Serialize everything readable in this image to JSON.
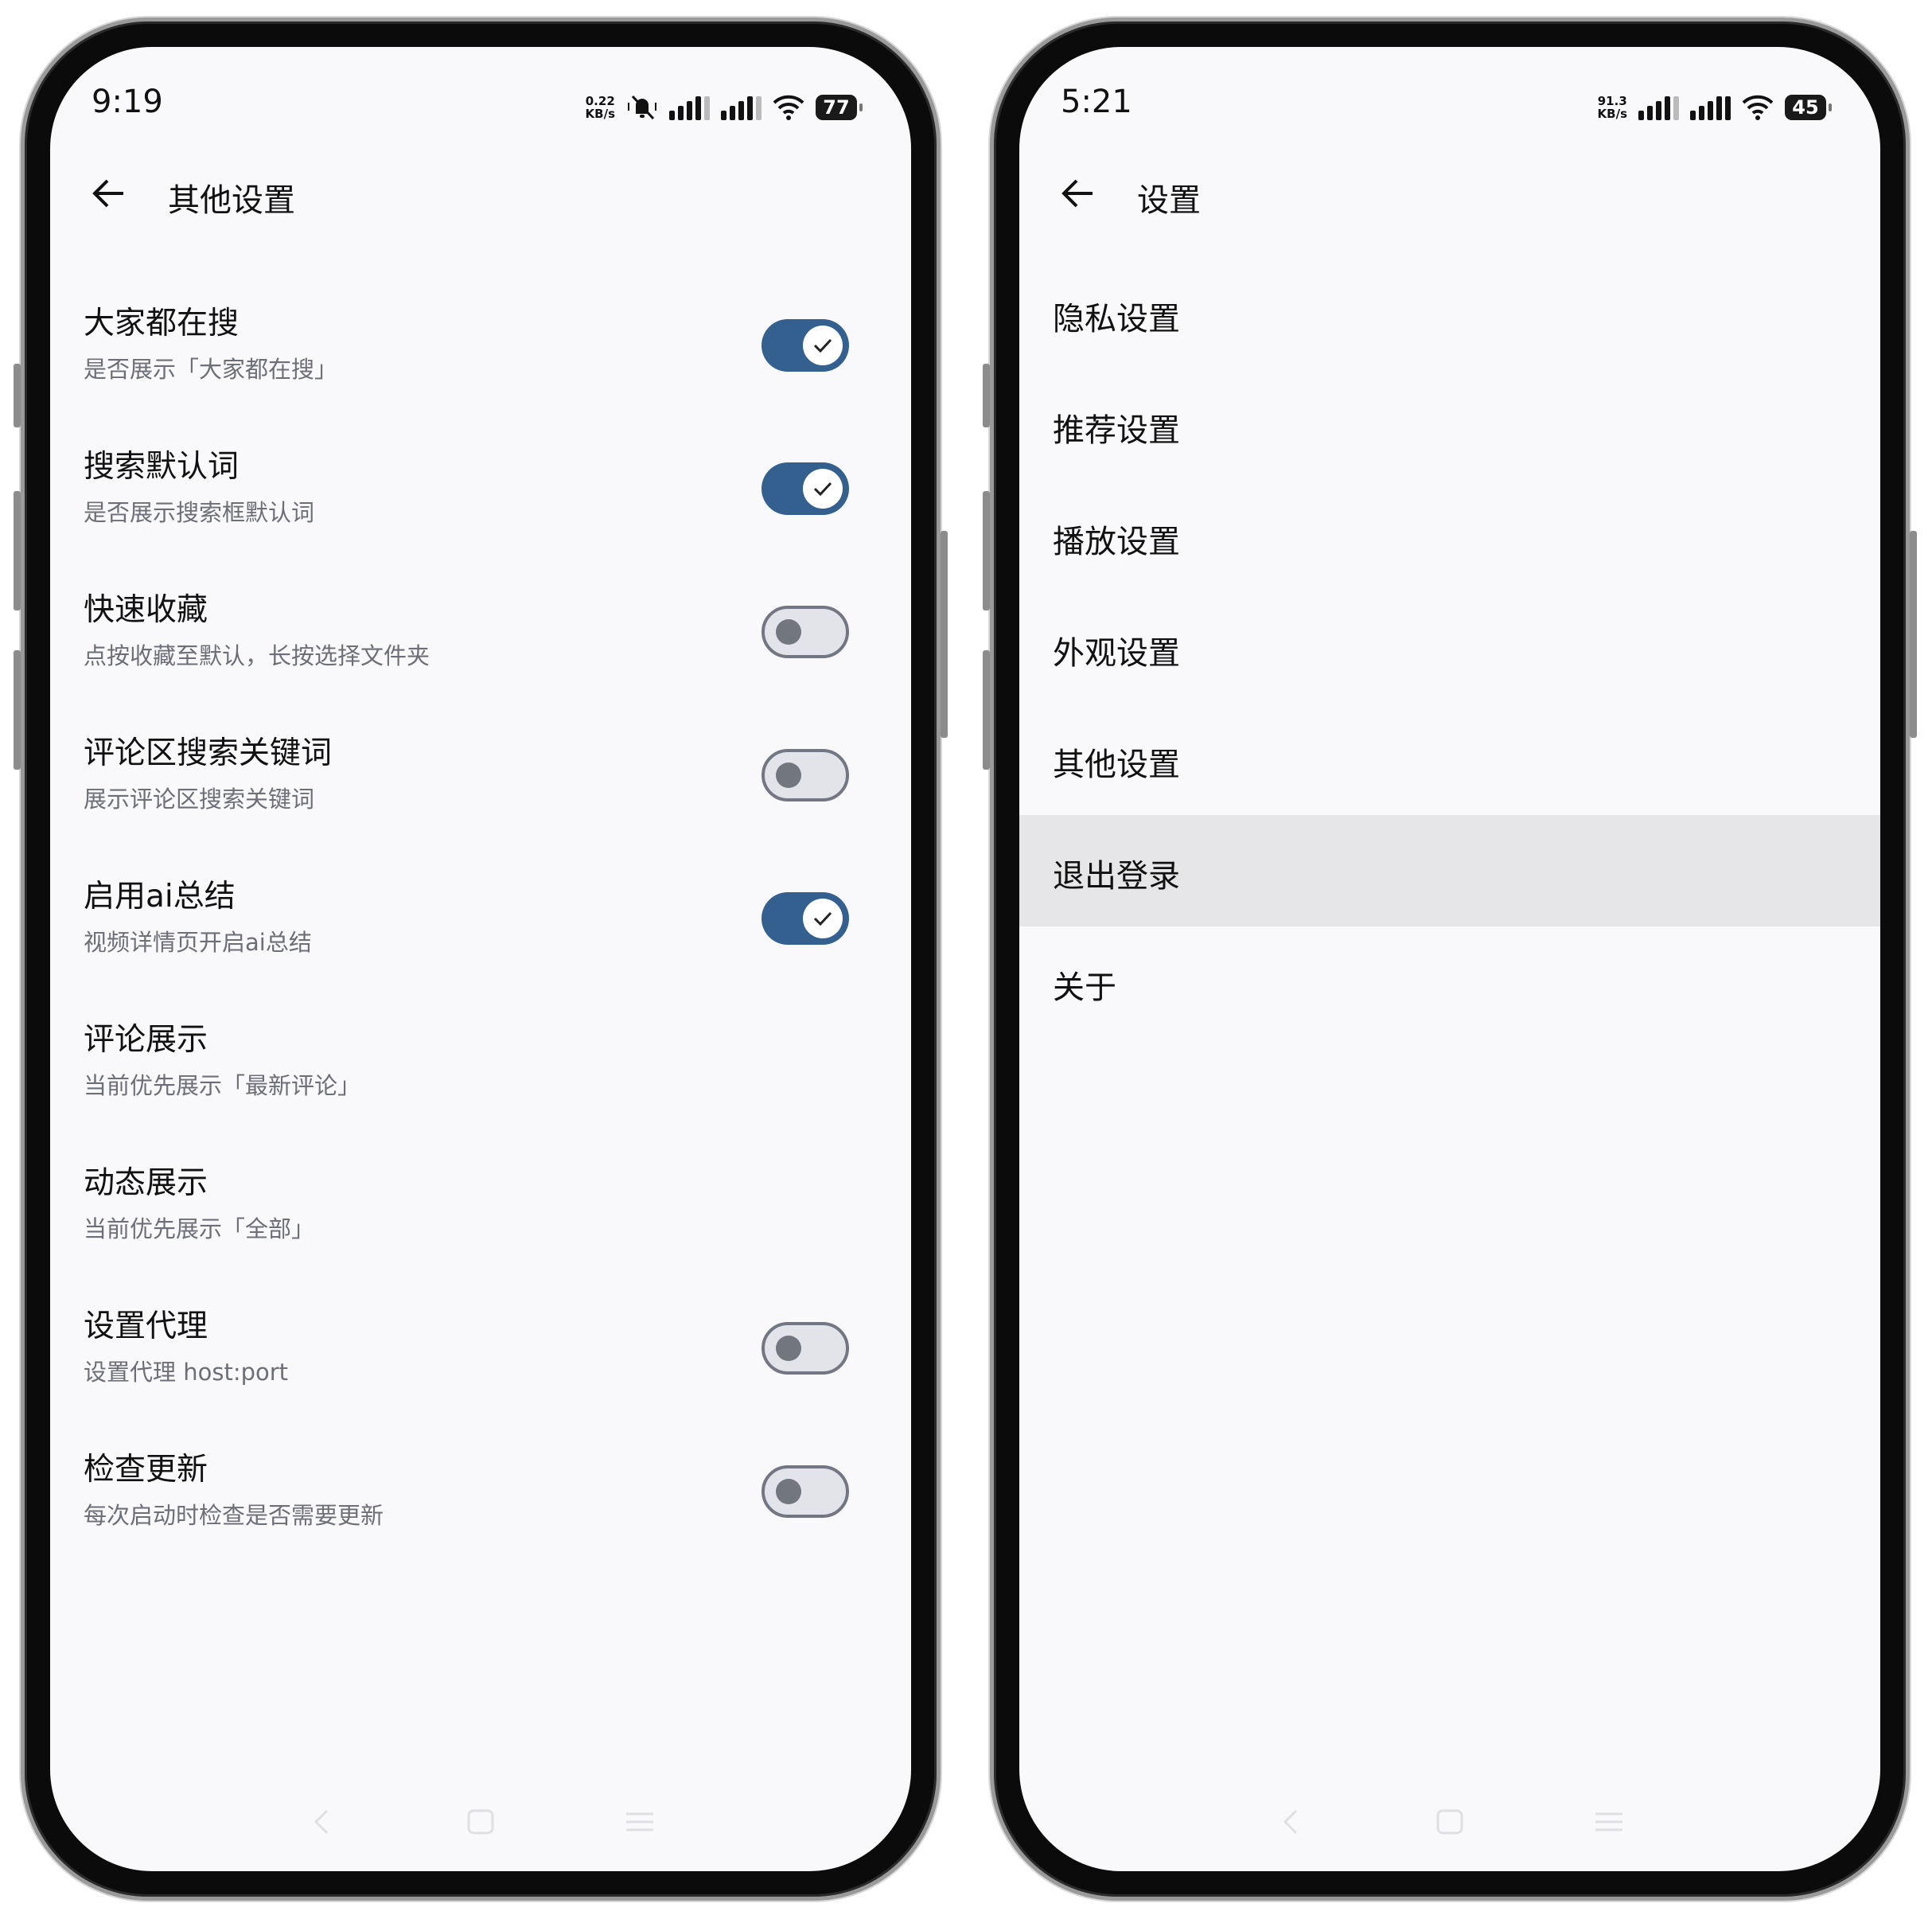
{
  "left_phone": {
    "status": {
      "time": "9:19",
      "net_speed_value": "0.22",
      "net_speed_unit": "KB/s",
      "battery": "77"
    },
    "app_bar": {
      "title": "其他设置"
    },
    "settings": [
      {
        "title": "大家都在搜",
        "subtitle": "是否展示「大家都在搜」",
        "toggle": "on"
      },
      {
        "title": "搜索默认词",
        "subtitle": "是否展示搜索框默认词",
        "toggle": "on"
      },
      {
        "title": "快速收藏",
        "subtitle": "点按收藏至默认，长按选择文件夹",
        "toggle": "off"
      },
      {
        "title": "评论区搜索关键词",
        "subtitle": "展示评论区搜索关键词",
        "toggle": "off"
      },
      {
        "title": "启用ai总结",
        "subtitle": "视频详情页开启ai总结",
        "toggle": "on"
      },
      {
        "title": "评论展示",
        "subtitle": "当前优先展示「最新评论」",
        "toggle": null
      },
      {
        "title": "动态展示",
        "subtitle": "当前优先展示「全部」",
        "toggle": null
      },
      {
        "title": "设置代理",
        "subtitle": "设置代理 host:port",
        "toggle": "off"
      },
      {
        "title": "检查更新",
        "subtitle": "每次启动时检查是否需要更新",
        "toggle": "off"
      }
    ]
  },
  "right_phone": {
    "status": {
      "time": "5:21",
      "net_speed_value": "91.3",
      "net_speed_unit": "KB/s",
      "battery": "45"
    },
    "app_bar": {
      "title": "设置"
    },
    "menu": [
      {
        "label": "隐私设置"
      },
      {
        "label": "推荐设置"
      },
      {
        "label": "播放设置"
      },
      {
        "label": "外观设置"
      },
      {
        "label": "其他设置"
      },
      {
        "label": "退出登录",
        "highlighted": true
      },
      {
        "label": "关于"
      }
    ]
  },
  "colors": {
    "toggle_on": "#33608e",
    "toggle_off_track": "#e3e4ea",
    "toggle_off_knob": "#72767f",
    "highlight_row": "#e6e6e8",
    "subtitle_text": "#6c6f77"
  }
}
